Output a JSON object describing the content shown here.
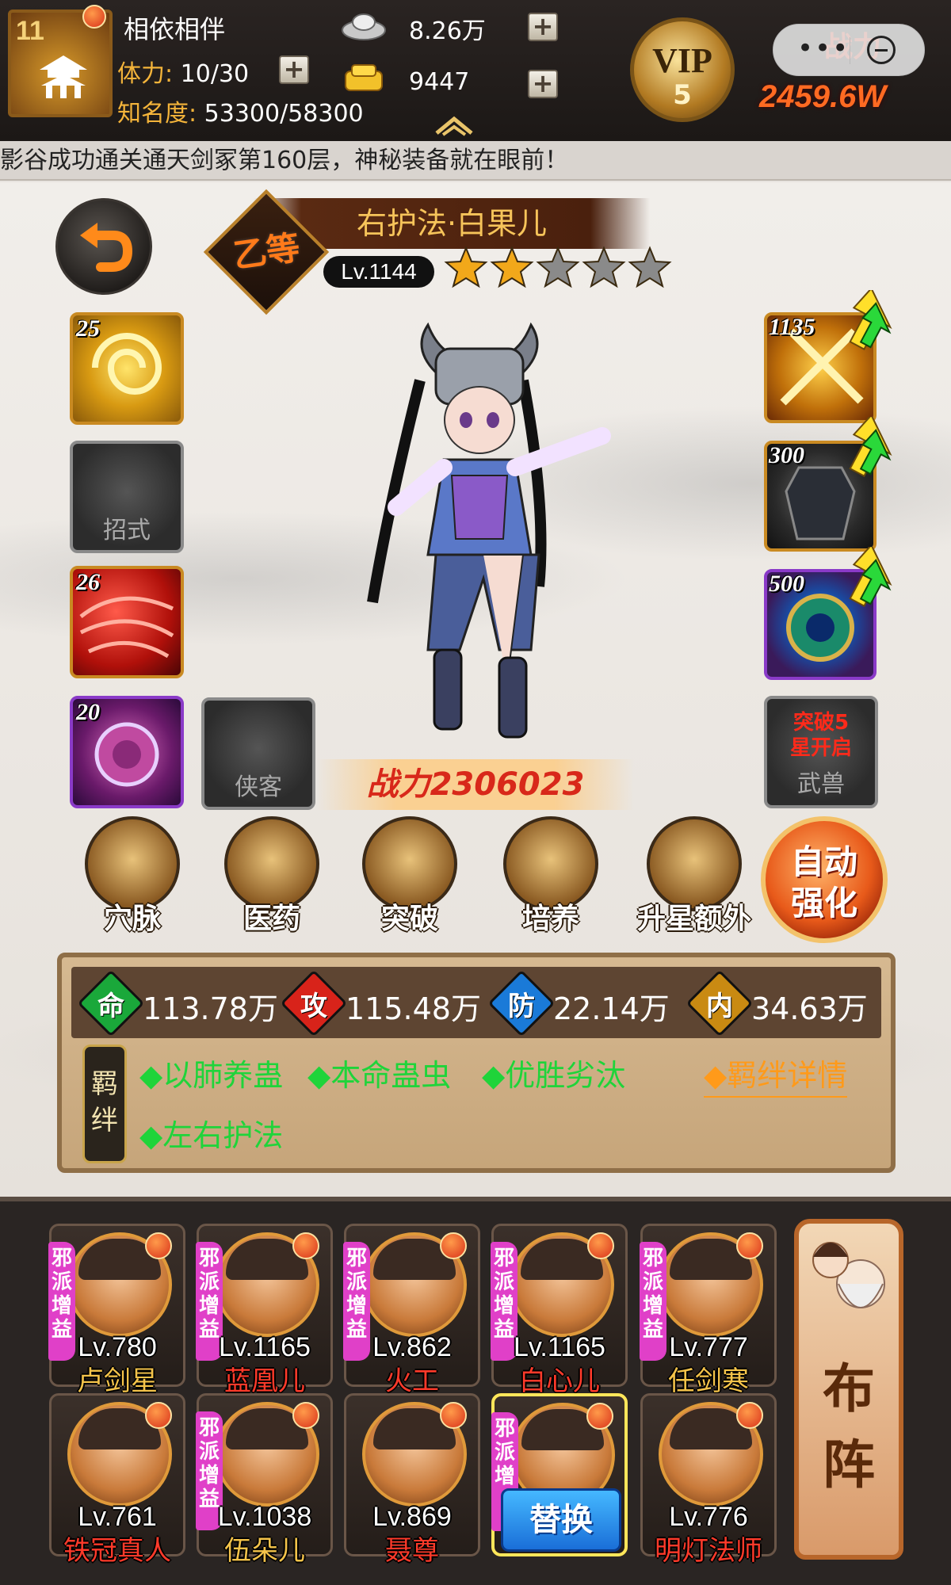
{
  "player": {
    "level": "11",
    "name": "相依相伴",
    "stamina_label": "体力:",
    "stamina_value": "10/30",
    "fame_label": "知名度:",
    "fame_value": "53300/58300"
  },
  "currency": {
    "silver": "8.26万",
    "gold": "9447"
  },
  "vip": {
    "label": "VIP",
    "level": "5"
  },
  "top_power": {
    "label": "战力",
    "value": "2459.6W"
  },
  "miniprogram": {
    "dots": "•••"
  },
  "marquee": {
    "text": "影谷成功通关通天剑冢第160层，神秘装备就在眼前！"
  },
  "hero": {
    "title": "右护法·白果儿",
    "grade": "乙等",
    "level": "Lv.1144",
    "stars_filled": 2,
    "stars_total": 5,
    "combat_power": "战力2306023"
  },
  "left_slots": [
    {
      "num": "25",
      "label": ""
    },
    {
      "num": "",
      "label": "招式"
    },
    {
      "num": "26",
      "label": ""
    },
    {
      "num": "20",
      "label": ""
    },
    {
      "num": "",
      "label": "侠客"
    }
  ],
  "right_slots": [
    {
      "num": "1135"
    },
    {
      "num": "300"
    },
    {
      "num": "500"
    }
  ],
  "beast_slot": {
    "warn": "突破5星开启",
    "label": "武兽"
  },
  "features": [
    {
      "label": "穴脉",
      "icon": "meridian-icon"
    },
    {
      "label": "医药",
      "icon": "medicine-icon"
    },
    {
      "label": "突破",
      "icon": "breakthrough-icon"
    },
    {
      "label": "培养",
      "icon": "cultivate-icon"
    },
    {
      "label": "升星额外",
      "icon": "star-up-extra-icon"
    }
  ],
  "auto_enhance": {
    "label": "自动强化"
  },
  "attributes": [
    {
      "char": "命",
      "value": "113.78万",
      "color": "#1aa83a"
    },
    {
      "char": "攻",
      "value": "115.48万",
      "color": "#d8231a"
    },
    {
      "char": "防",
      "value": "22.14万",
      "color": "#1a7ad8"
    },
    {
      "char": "内",
      "value": "34.63万",
      "color": "#c98a12"
    }
  ],
  "bonds": {
    "tag": "羁绊",
    "items": [
      "◆以肺养蛊",
      "◆本命蛊虫",
      "◆优胜劣汰",
      "◆左右护法"
    ],
    "detail_link": "◆羁绊详情"
  },
  "roster": [
    {
      "level": "Lv.780",
      "name": "卢剑星",
      "name_color": "#f4c34a",
      "ribbon": "邪派增益"
    },
    {
      "level": "Lv.1165",
      "name": "蓝凰儿",
      "name_color": "#ff3a2a",
      "ribbon": "邪派增益"
    },
    {
      "level": "Lv.862",
      "name": "火工",
      "name_color": "#ff3a2a",
      "ribbon": "邪派增益"
    },
    {
      "level": "Lv.1165",
      "name": "白心儿",
      "name_color": "#ff3a2a",
      "ribbon": "邪派增益"
    },
    {
      "level": "Lv.777",
      "name": "任剑寒",
      "name_color": "#f4c34a",
      "ribbon": "邪派增益"
    },
    {
      "level": "Lv.761",
      "name": "铁冠真人",
      "name_color": "#ff3a2a",
      "ribbon": ""
    },
    {
      "level": "Lv.1038",
      "name": "伍朵儿",
      "name_color": "#f4c34a",
      "ribbon": "邪派增益"
    },
    {
      "level": "Lv.869",
      "name": "聂尊",
      "name_color": "#ff3a2a",
      "ribbon": ""
    },
    {
      "level": "",
      "name": "",
      "name_color": "#ffffff",
      "ribbon": "邪派增",
      "swap_label": "替换"
    },
    {
      "level": "Lv.776",
      "name": "明灯法师",
      "name_color": "#ff3a2a",
      "ribbon": ""
    }
  ],
  "formation": {
    "label": "布阵"
  }
}
